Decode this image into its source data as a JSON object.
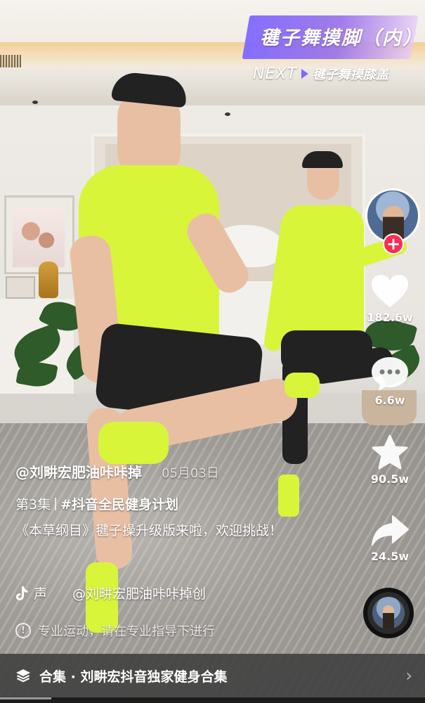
{
  "banner": {
    "title": "毽子舞摸脚（内）",
    "next_word": "NEXT",
    "next_title": "毽子舞摸膝盖"
  },
  "creator": {
    "handle": "@刘畊宏肥油咔咔掉",
    "date": "05月03日",
    "avatar_icon": "avatar-photo-icon",
    "follow_icon": "plus-icon"
  },
  "caption": {
    "episode": "第3集",
    "hashtag": "#抖音全民健身计划",
    "text": "《本草纲目》毽子操升级版来啦，欢迎挑战！"
  },
  "actions": {
    "like_count": "182.6w",
    "comment_count": "6.6w",
    "favorite_count": "90.5w",
    "share_count": "24.5w"
  },
  "music": {
    "icon": "tiktok-note-icon",
    "label": "声",
    "title": "@刘畊宏肥油咔咔掉创"
  },
  "notice": {
    "text": "专业运动，请在专业指导下进行"
  },
  "collection": {
    "icon": "stack-layers-icon",
    "text": "合集 · 刘畊宏抖音独家健身合集"
  },
  "playback": {
    "progress": 0.12
  },
  "colors": {
    "follow": "#fe2c55",
    "banner": "#7e68ff",
    "shirt": "#d8f53a"
  }
}
